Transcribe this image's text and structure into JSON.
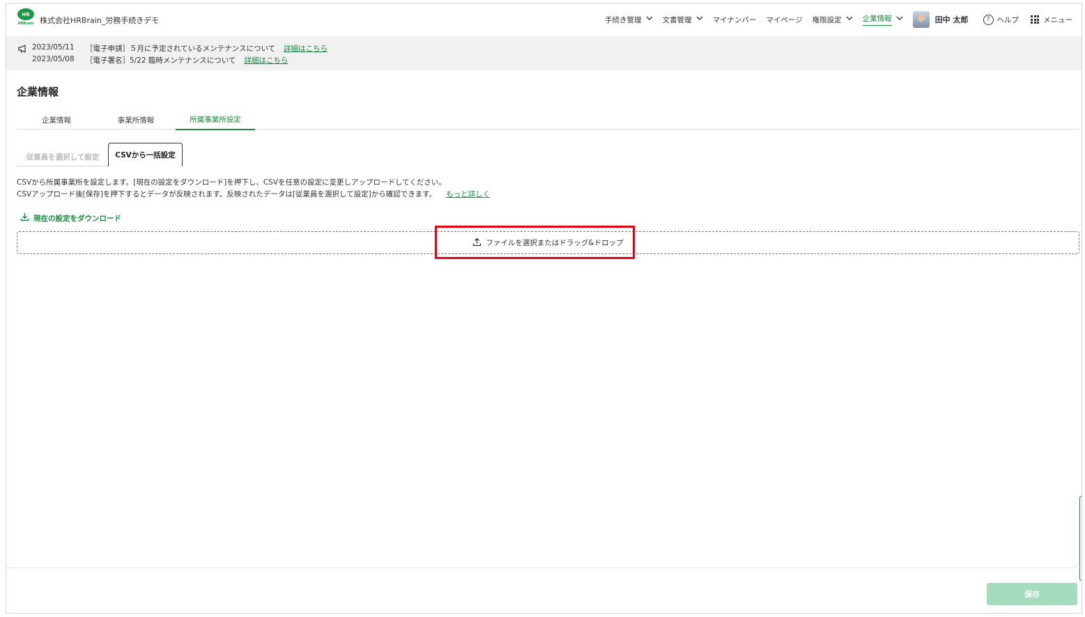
{
  "header": {
    "logo_text": "HR",
    "logo_word": "HRBrain",
    "company_name": "株式会社HRBrain_労務手続きデモ",
    "nav": [
      {
        "label": "手続き管理",
        "has_dropdown": true
      },
      {
        "label": "文書管理",
        "has_dropdown": true
      },
      {
        "label": "マイナンバー",
        "has_dropdown": false
      },
      {
        "label": "マイページ",
        "has_dropdown": false
      },
      {
        "label": "権限設定",
        "has_dropdown": true
      },
      {
        "label": "企業情報",
        "has_dropdown": true,
        "active": true
      }
    ],
    "user_name": "田中 太郎",
    "help_label": "ヘルプ",
    "menu_label": "メニュー"
  },
  "notices": [
    {
      "date": "2023/05/11",
      "message": "［電子申請］５月に予定されているメンテナンスについて",
      "link": "詳細はこちら"
    },
    {
      "date": "2023/05/08",
      "message": "［電子署名］5/22 臨時メンテナンスについて",
      "link": "詳細はこちら"
    }
  ],
  "page": {
    "title": "企業情報",
    "tabs": [
      {
        "label": "企業情報"
      },
      {
        "label": "事業所情報"
      },
      {
        "label": "所属事業所設定",
        "active": true
      }
    ],
    "subtabs": {
      "select_employees": "従業員を選択して設定",
      "csv_bulk": "CSVから一括設定"
    },
    "description_line1": "CSVから所属事業所を設定します。[現在の設定をダウンロード]を押下し、CSVを任意の設定に変更しアップロードしてください。",
    "description_line2": "CSVアップロード後[保存]を押下するとデータが反映されます。反映されたデータは[従業員を選択して設定]から確認できます。",
    "more_link": "もっと詳しく",
    "download_label": "現在の設定をダウンロード",
    "dropzone_label": "ファイルを選択またはドラッグ&ドロップ",
    "save_label": "保存"
  },
  "colors": {
    "brand_green": "#1a8a40",
    "highlight_red": "#e60012",
    "save_disabled": "#a5dcbe"
  }
}
